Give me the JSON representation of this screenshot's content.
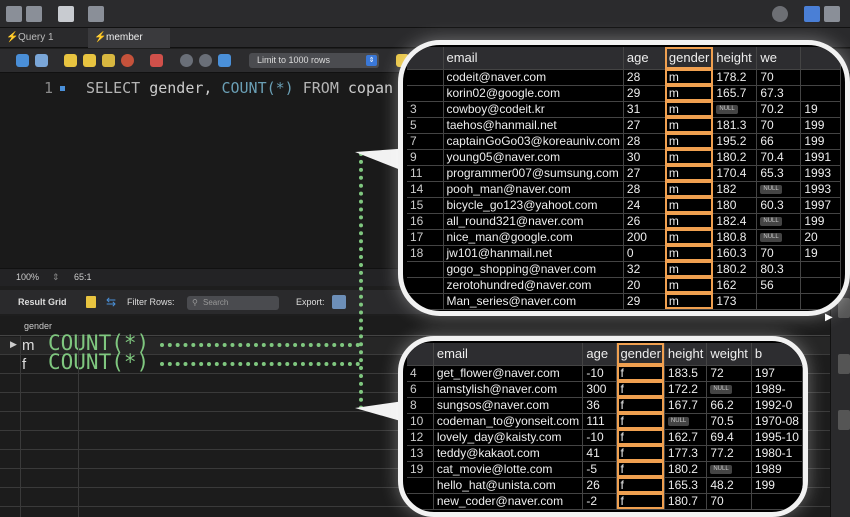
{
  "tabs": [
    {
      "label": "Query 1"
    },
    {
      "label": "member"
    }
  ],
  "limit_label": "Limit to 1000 rows",
  "editor": {
    "line_number": "1",
    "sql_keyword1": "SELECT",
    "sql_col": " gender, ",
    "sql_fn": "COUNT(*)",
    "sql_keyword2": " FROM",
    "sql_rest": " copan"
  },
  "status": {
    "zoom": "100%",
    "position": "65:1"
  },
  "result_bar": {
    "title": "Result Grid",
    "filter_label": "Filter Rows:",
    "search_placeholder": "Search",
    "export_label": "Export:"
  },
  "grid": {
    "column": "gender",
    "rows": [
      {
        "value": "m",
        "count": "COUNT(*)"
      },
      {
        "value": "f",
        "count": "COUNT(*)"
      }
    ]
  },
  "popup_top": {
    "headers": [
      "email",
      "age",
      "gender",
      "height",
      "we"
    ],
    "rows": [
      [
        "",
        "codeit@naver.com",
        "28",
        "m",
        "178.2",
        "70",
        ""
      ],
      [
        "",
        "korin02@google.com",
        "29",
        "m",
        "165.7",
        "67.3",
        ""
      ],
      [
        "3",
        "cowboy@codeit.kr",
        "31",
        "m",
        "NULL",
        "70.2",
        "19"
      ],
      [
        "5",
        "taehos@hanmail.net",
        "27",
        "m",
        "181.3",
        "70",
        "199"
      ],
      [
        "7",
        "captainGoGo03@koreauniv.com",
        "28",
        "m",
        "195.2",
        "66",
        "199"
      ],
      [
        "9",
        "young05@naver.com",
        "30",
        "m",
        "180.2",
        "70.4",
        "1991"
      ],
      [
        "11",
        "programmer007@sumsung.com",
        "27",
        "m",
        "170.4",
        "65.3",
        "1993"
      ],
      [
        "14",
        "pooh_man@naver.com",
        "28",
        "m",
        "182",
        "NULL",
        "1993"
      ],
      [
        "15",
        "bicycle_go123@yahoot.com",
        "24",
        "m",
        "180",
        "60.3",
        "1997"
      ],
      [
        "16",
        "all_round321@naver.com",
        "26",
        "m",
        "182.4",
        "NULL",
        "199"
      ],
      [
        "17",
        "nice_man@google.com",
        "200",
        "m",
        "180.8",
        "NULL",
        "20"
      ],
      [
        "18",
        "jw101@hanmail.net",
        "0",
        "m",
        "160.3",
        "70",
        "19"
      ],
      [
        "",
        "gogo_shopping@naver.com",
        "32",
        "m",
        "180.2",
        "80.3",
        ""
      ],
      [
        "",
        "zerotohundred@naver.com",
        "20",
        "m",
        "162",
        "56",
        ""
      ],
      [
        "",
        "Man_series@naver.com",
        "29",
        "m",
        "173",
        "",
        ""
      ]
    ]
  },
  "popup_bottom": {
    "headers": [
      "email",
      "age",
      "gender",
      "height",
      "weight",
      "b"
    ],
    "rows": [
      [
        "4",
        "get_flower@naver.com",
        "-10",
        "f",
        "183.5",
        "72",
        "197"
      ],
      [
        "6",
        "iamstylish@naver.com",
        "300",
        "f",
        "172.2",
        "NULL",
        "1989-"
      ],
      [
        "8",
        "sungsos@naver.com",
        "36",
        "f",
        "167.7",
        "66.2",
        "1992-0"
      ],
      [
        "10",
        "codeman_to@yonseit.com",
        "111",
        "f",
        "NULL",
        "70.5",
        "1970-08"
      ],
      [
        "12",
        "lovely_day@kaisty.com",
        "-10",
        "f",
        "162.7",
        "69.4",
        "1995-10"
      ],
      [
        "13",
        "teddy@kakaot.com",
        "41",
        "f",
        "177.3",
        "77.2",
        "1980-1"
      ],
      [
        "19",
        "cat_movie@lotte.com",
        "-5",
        "f",
        "180.2",
        "NULL",
        "1989"
      ],
      [
        "",
        "hello_hat@unista.com",
        "26",
        "f",
        "165.3",
        "48.2",
        "199"
      ],
      [
        "",
        "new_coder@naver.com",
        "-2",
        "f",
        "180.7",
        "70",
        ""
      ]
    ]
  }
}
